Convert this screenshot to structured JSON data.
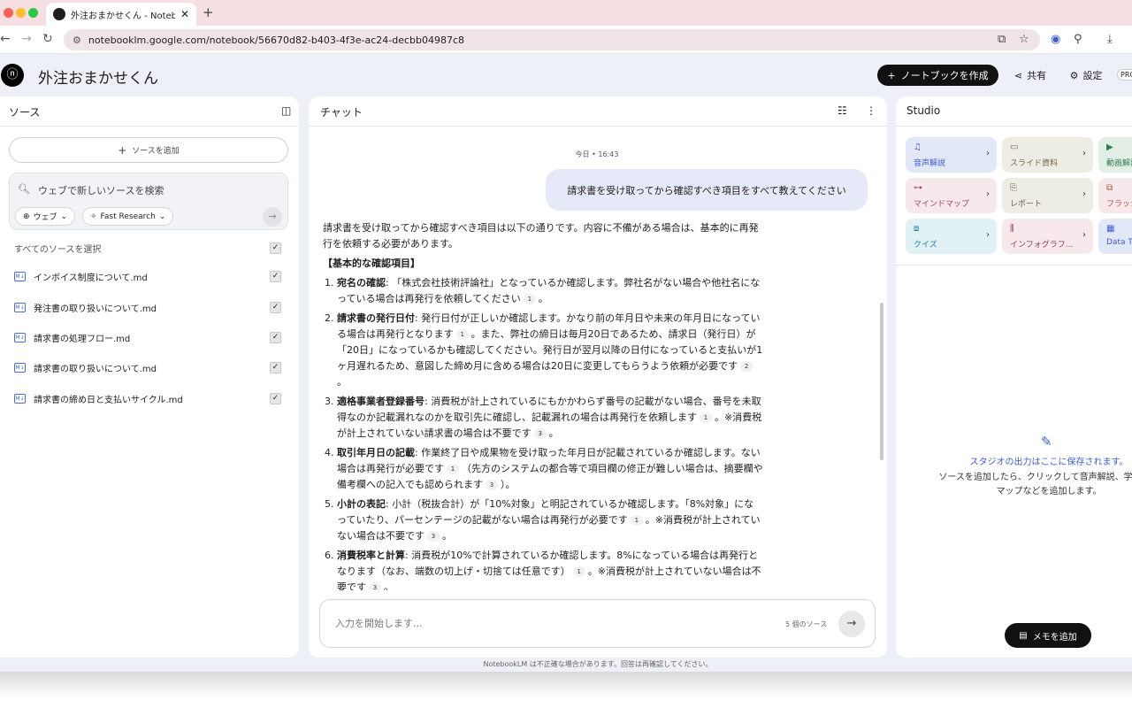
{
  "browser": {
    "tab_title": "外注おまかせくん - NotebookLM",
    "tab_close": "✕",
    "new_tab": "+",
    "url": "notebooklm.google.com/notebook/56670d82-b403-4f3e-ac24-decbb04987c8",
    "nav": {
      "back": "←",
      "forward": "→",
      "reload": "↻"
    }
  },
  "header": {
    "logo_glyph": "ⓝ",
    "title": "外注おまかせくん",
    "create_button": "ノートブックを作成",
    "share_button": "共有",
    "settings_button": "設定",
    "pro_badge": "PRO"
  },
  "sources": {
    "title": "ソース",
    "add_button": "ソースを追加",
    "search_placeholder": "ウェブで新しいソースを検索",
    "chip_web": "ウェブ",
    "chip_research": "Fast Research",
    "select_all": "すべてのソースを選択",
    "items": [
      {
        "label": "インボイス制度について.md",
        "checked": true
      },
      {
        "label": "発注書の取り扱いについて.md",
        "checked": true
      },
      {
        "label": "請求書の処理フロー.md",
        "checked": true
      },
      {
        "label": "請求書の取り扱いについて.md",
        "checked": true
      },
      {
        "label": "請求書の締め日と支払いサイクル.md",
        "checked": true
      }
    ]
  },
  "chat": {
    "title": "チャット",
    "timestamp": "今日 • 16:43",
    "user_message": "請求書を受け取ってから確認すべき項目をすべて教えてください",
    "answer": {
      "intro": "請求書を受け取ってから確認すべき項目は以下の通りです。内容に不備がある場合は、基本的に再発行を依頼する必要があります。",
      "heading": "【基本的な確認項目】",
      "items": [
        {
          "num": "1.",
          "term": "宛名の確認",
          "text": ": 「株式会社技術評論社」となっているか確認します。弊社名がない場合や他社名になっている場合は再発行を依頼してください",
          "c1": "1",
          "text2": "。",
          "c2": "",
          "text3": ""
        },
        {
          "num": "2.",
          "term": "請求書の発行日付",
          "text": ": 発行日付が正しいか確認します。かなり前の年月日や未来の年月日になっている場合は再発行となります",
          "c1": "1",
          "text2": "。また、弊社の締日は毎月20日であるため、請求日（発行日）が「20日」になっているかも確認してください。発行日が翌月以降の日付になっていると支払いが1ヶ月遅れるため、意図した締め月に含める場合は20日に変更してもらうよう依頼が必要です",
          "c2": "2",
          "text3": "。"
        },
        {
          "num": "3.",
          "term": "適格事業者登録番号",
          "text": ": 消費税が計上されているにもかかわらず番号の記載がない場合、番号を未取得なのか記載漏れなのかを取引先に確認し、記載漏れの場合は再発行を依頼します",
          "c1": "1",
          "text2": "。※消費税が計上されていない請求書の場合は不要です",
          "c2": "3",
          "text3": "。"
        },
        {
          "num": "4.",
          "term": "取引年月日の記載",
          "text": ": 作業終了日や成果物を受け取った年月日が記載されているか確認します。ない場合は再発行が必要です",
          "c1": "1",
          "text2": "（先方のシステムの都合等で項目欄の修正が難しい場合は、摘要欄や備考欄への記入でも認められます",
          "c2": "3",
          "text3": "）。"
        },
        {
          "num": "5.",
          "term": "小計の表記",
          "text": ": 小計（税抜合計）が「10%対象」と明記されているか確認します。「8%対象」になっていたり、パーセンテージの記載がない場合は再発行が必要です",
          "c1": "1",
          "text2": "。※消費税が計上されていない場合は不要です",
          "c2": "3",
          "text3": "。"
        },
        {
          "num": "6.",
          "term": "消費税率と計算",
          "text": ": 消費税が10%で計算されているか確認します。8%になっている場合は再発行となります（なお、端数の切上げ・切捨ては任意です）",
          "c1": "1",
          "text2": "。※消費税が計上されていない場合は不要です",
          "c2": "3",
          "text3": "。"
        }
      ]
    },
    "input_placeholder": "入力を開始します...",
    "source_count": "5 個のソース",
    "footer_note": "NotebookLM は不正確な場合があります。回答は再確認してください。"
  },
  "studio": {
    "title": "Studio",
    "cards": [
      {
        "label": "音声解説",
        "icon": "♫"
      },
      {
        "label": "スライド資料",
        "icon": "▭"
      },
      {
        "label": "動画解説",
        "icon": "▶"
      },
      {
        "label": "マインドマップ",
        "icon": "⊶"
      },
      {
        "label": "レポート",
        "icon": "⎘"
      },
      {
        "label": "フラッシュ",
        "icon": "⧉"
      },
      {
        "label": "クイズ",
        "icon": "⧈"
      },
      {
        "label": "インフォグラフ...",
        "icon": "⫼"
      },
      {
        "label": "Data Ta",
        "icon": "▦"
      }
    ],
    "empty_title": "スタジオの出力はここに保存されます。",
    "empty_desc1": "ソースを追加したら、クリックして音声解説、学習ガイ",
    "empty_desc2": "マップなどを追加します。",
    "memo_button": "メモを追加"
  },
  "colors": {
    "card_blue": "#e3e8f9",
    "card_beige": "#eeede3",
    "card_green": "#e3efe6",
    "card_pink": "#f7e8ec",
    "card_cyan": "#e1f2f7"
  }
}
